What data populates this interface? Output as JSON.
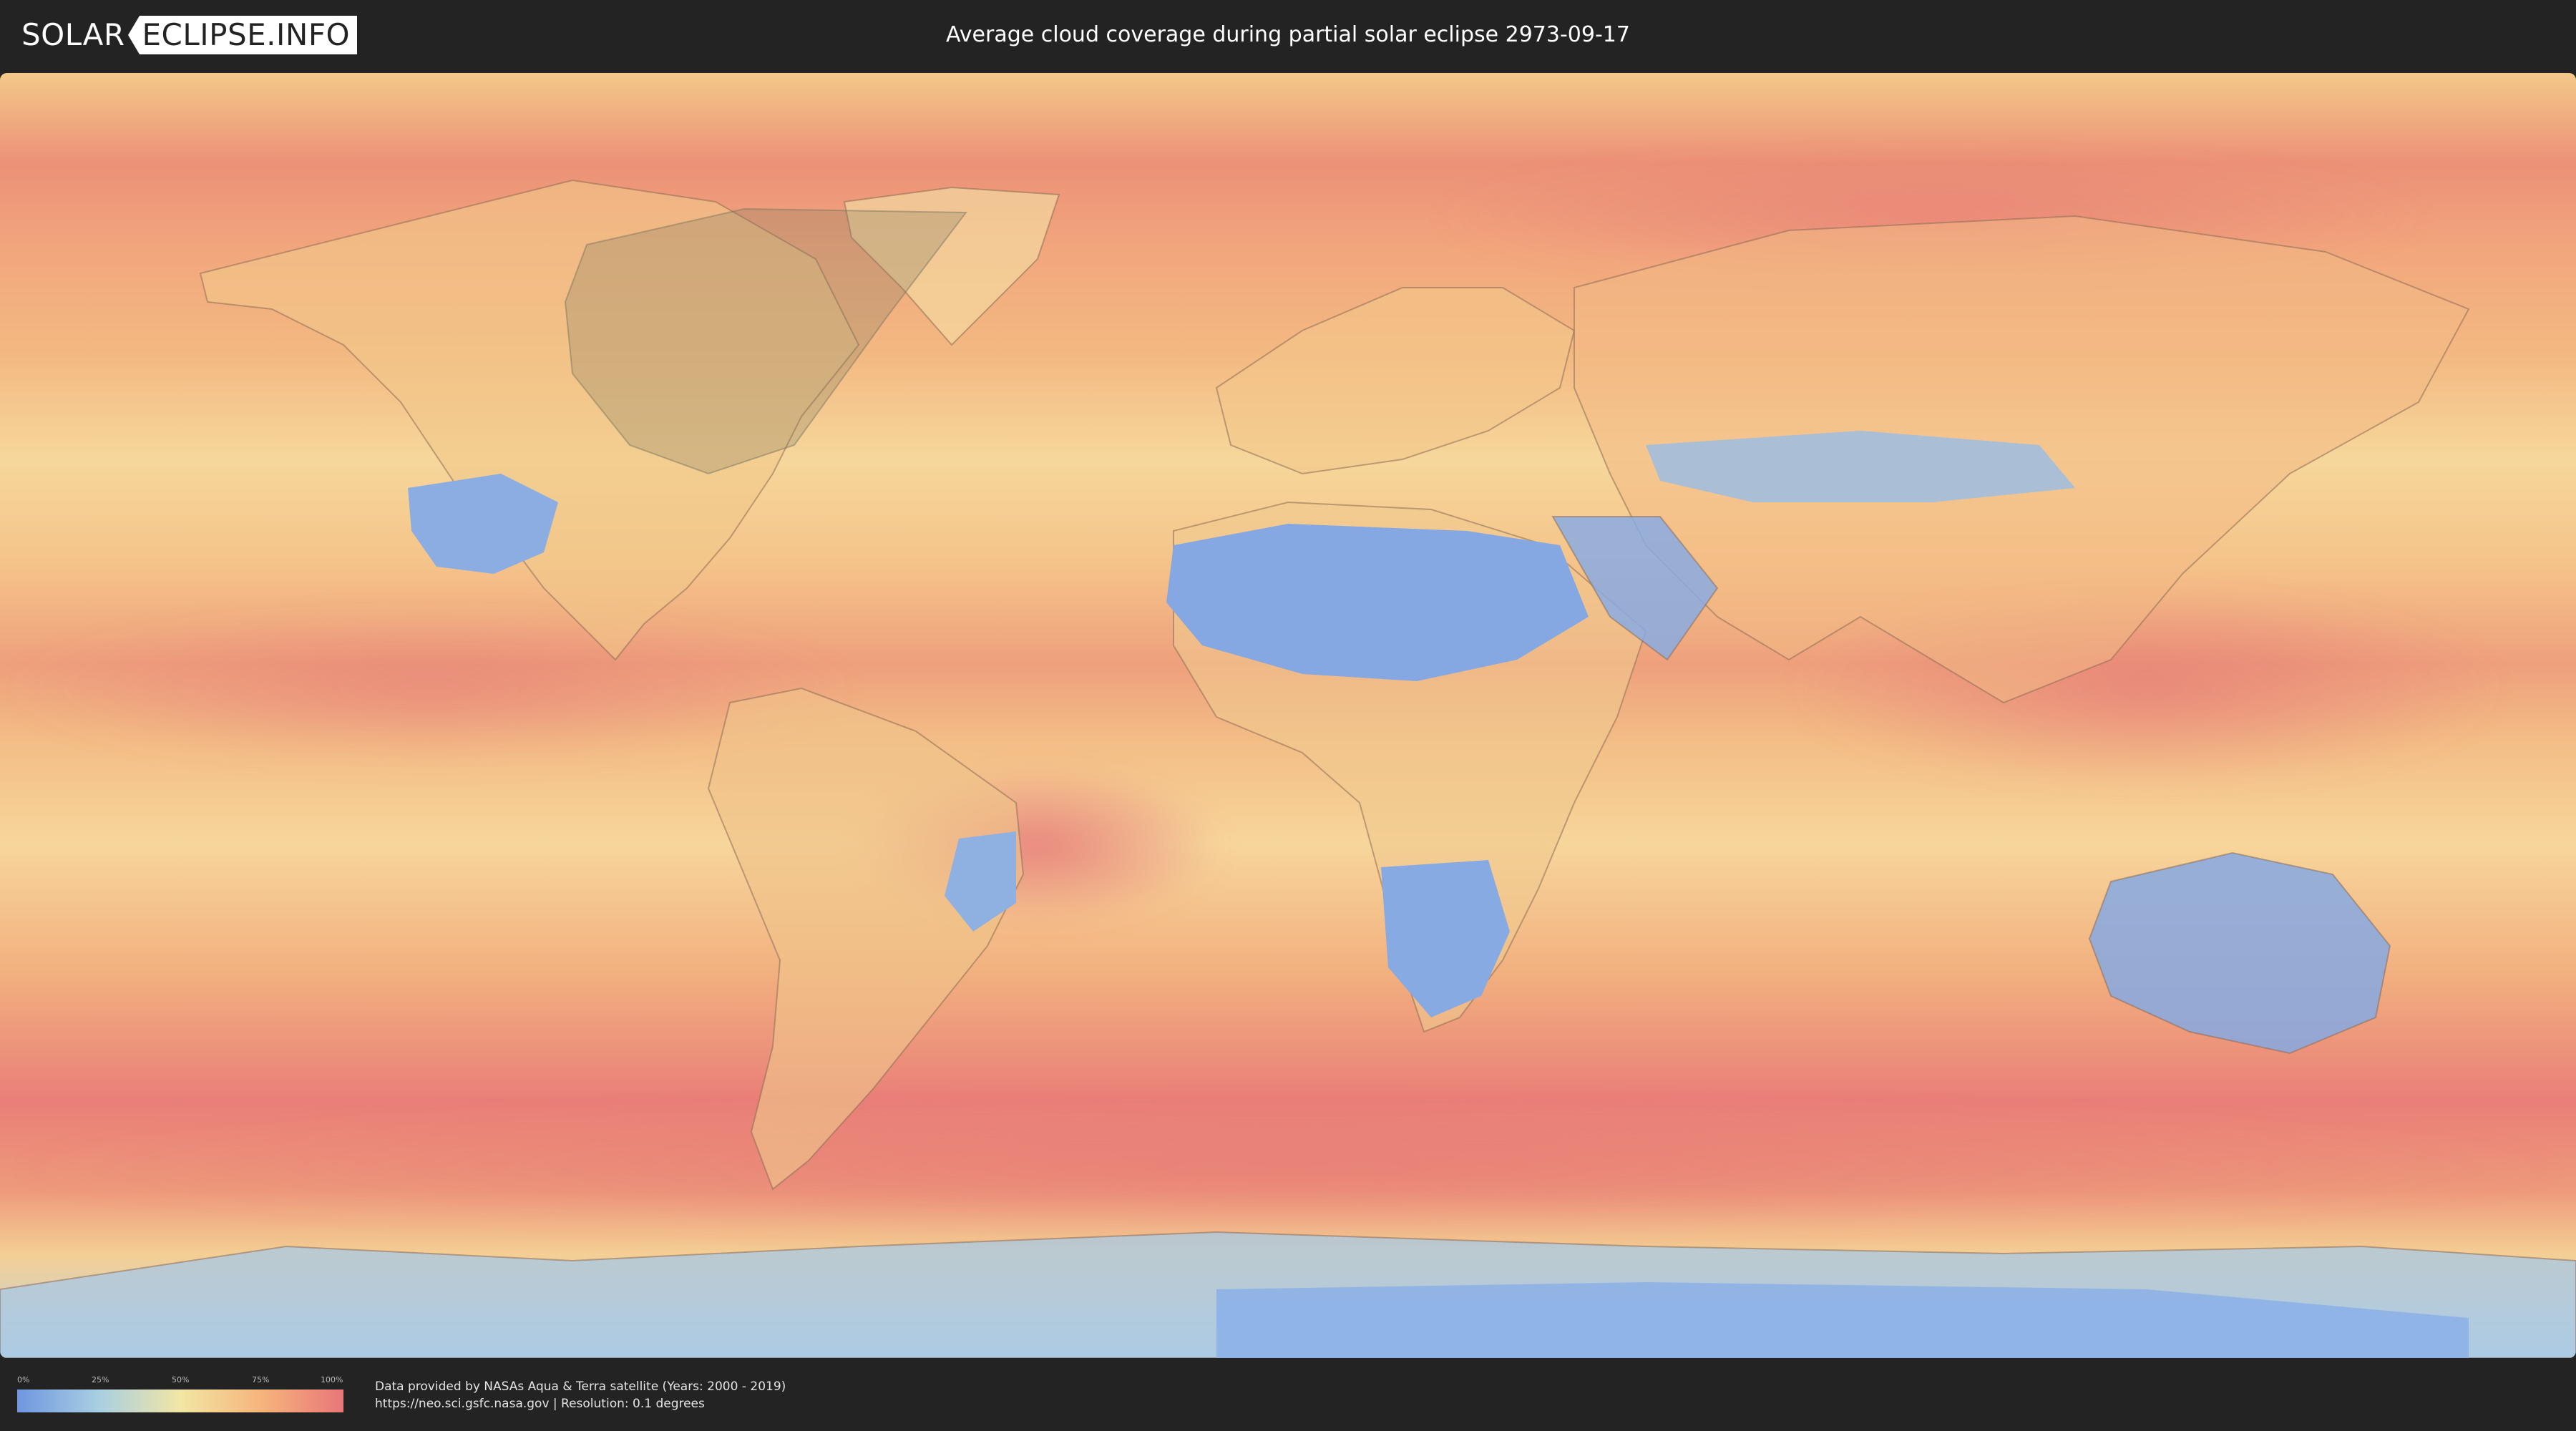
{
  "header": {
    "logo_left": "SOLAR",
    "logo_right": "ECLIPSE.INFO",
    "title": "Average cloud coverage during partial solar eclipse 2973-09-17"
  },
  "map": {
    "description": "world-cloud-coverage-map",
    "eclipse_shadow_color": "#7f7a60"
  },
  "legend": {
    "ticks": [
      "0%",
      "25%",
      "50%",
      "75%",
      "100%"
    ],
    "gradient": [
      "#6f96e0",
      "#a9cfe2",
      "#f2e6a4",
      "#f6b47b",
      "#e8767a"
    ]
  },
  "footer": {
    "credit_line1": "Data provided by NASAs Aqua & Terra satellite (Years: 2000 - 2019)",
    "credit_line2": "https://neo.sci.gsfc.nasa.gov | Resolution: 0.1 degrees"
  },
  "colors": {
    "background": "#232323",
    "clear_sky": "#6f96e0",
    "partly": "#f2e6a4",
    "cloudy": "#e8767a"
  }
}
